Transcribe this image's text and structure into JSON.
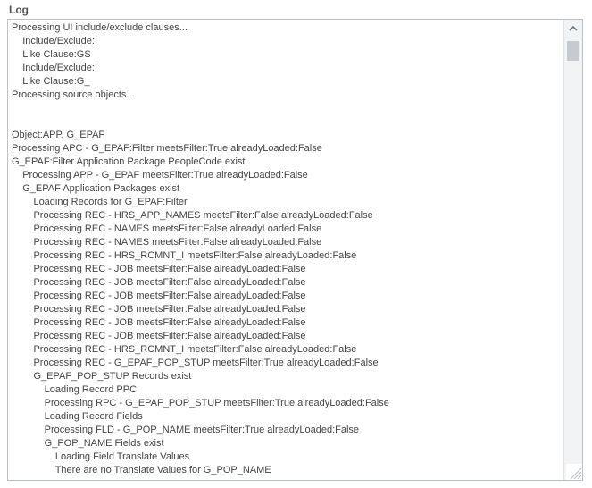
{
  "panel": {
    "title": "Log"
  },
  "log": {
    "lines": [
      "Processing UI include/exclude clauses...",
      "    Include/Exclude:I",
      "    Like Clause:GS",
      "    Include/Exclude:I",
      "    Like Clause:G_",
      "Processing source objects...",
      "",
      "",
      "Object:APP, G_EPAF",
      "Processing APC - G_EPAF:Filter meetsFilter:True alreadyLoaded:False",
      "G_EPAF:Filter Application Package PeopleCode exist",
      "    Processing APP - G_EPAF meetsFilter:True alreadyLoaded:False",
      "    G_EPAF Application Packages exist",
      "        Loading Records for G_EPAF:Filter",
      "        Processing REC - HRS_APP_NAMES meetsFilter:False alreadyLoaded:False",
      "        Processing REC - NAMES meetsFilter:False alreadyLoaded:False",
      "        Processing REC - NAMES meetsFilter:False alreadyLoaded:False",
      "        Processing REC - HRS_RCMNT_I meetsFilter:False alreadyLoaded:False",
      "        Processing REC - JOB meetsFilter:False alreadyLoaded:False",
      "        Processing REC - JOB meetsFilter:False alreadyLoaded:False",
      "        Processing REC - JOB meetsFilter:False alreadyLoaded:False",
      "        Processing REC - JOB meetsFilter:False alreadyLoaded:False",
      "        Processing REC - JOB meetsFilter:False alreadyLoaded:False",
      "        Processing REC - JOB meetsFilter:False alreadyLoaded:False",
      "        Processing REC - HRS_RCMNT_I meetsFilter:False alreadyLoaded:False",
      "        Processing REC - G_EPAF_POP_STUP meetsFilter:True alreadyLoaded:False",
      "        G_EPAF_POP_STUP Records exist",
      "            Loading Record PPC",
      "            Processing RPC - G_EPAF_POP_STUP meetsFilter:True alreadyLoaded:False",
      "            Loading Record Fields",
      "            Processing FLD - G_POP_NAME meetsFilter:True alreadyLoaded:False",
      "            G_POP_NAME Fields exist",
      "                Loading Field Translate Values",
      "                There are no Translate Values for G_POP_NAME"
    ]
  }
}
